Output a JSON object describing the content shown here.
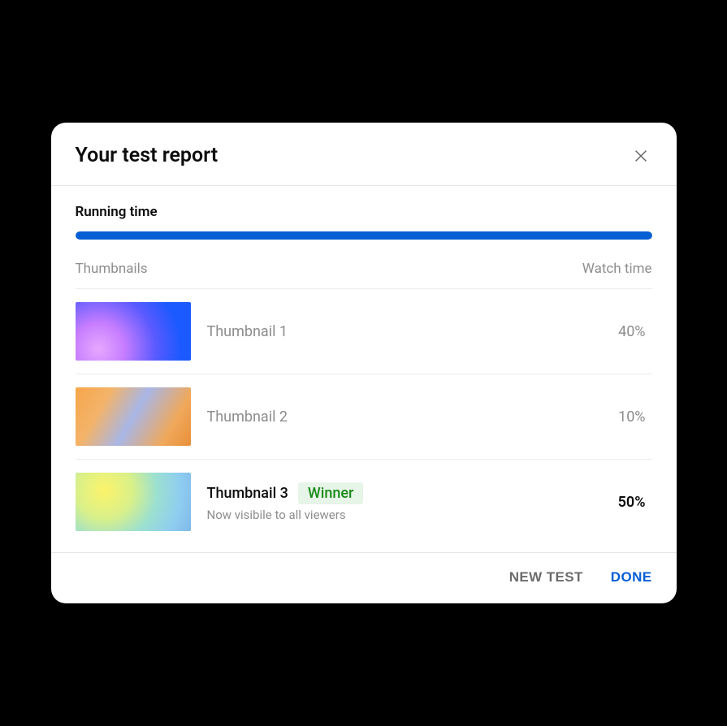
{
  "dialog": {
    "title": "Your test report",
    "running_label": "Running time",
    "progress_percent": 100,
    "columns": {
      "left": "Thumbnails",
      "right": "Watch time"
    },
    "rows": [
      {
        "name": "Thumbnail 1",
        "watch_time": "40%",
        "winner": false,
        "subtitle": ""
      },
      {
        "name": "Thumbnail 2",
        "watch_time": "10%",
        "winner": false,
        "subtitle": ""
      },
      {
        "name": "Thumbnail 3",
        "watch_time": "50%",
        "winner": true,
        "winner_label": "Winner",
        "subtitle": "Now visibile to all viewers"
      }
    ],
    "footer": {
      "new_test": "NEW TEST",
      "done": "DONE"
    }
  },
  "colors": {
    "accent": "#065fd4",
    "winner": "#1a8a1a"
  }
}
